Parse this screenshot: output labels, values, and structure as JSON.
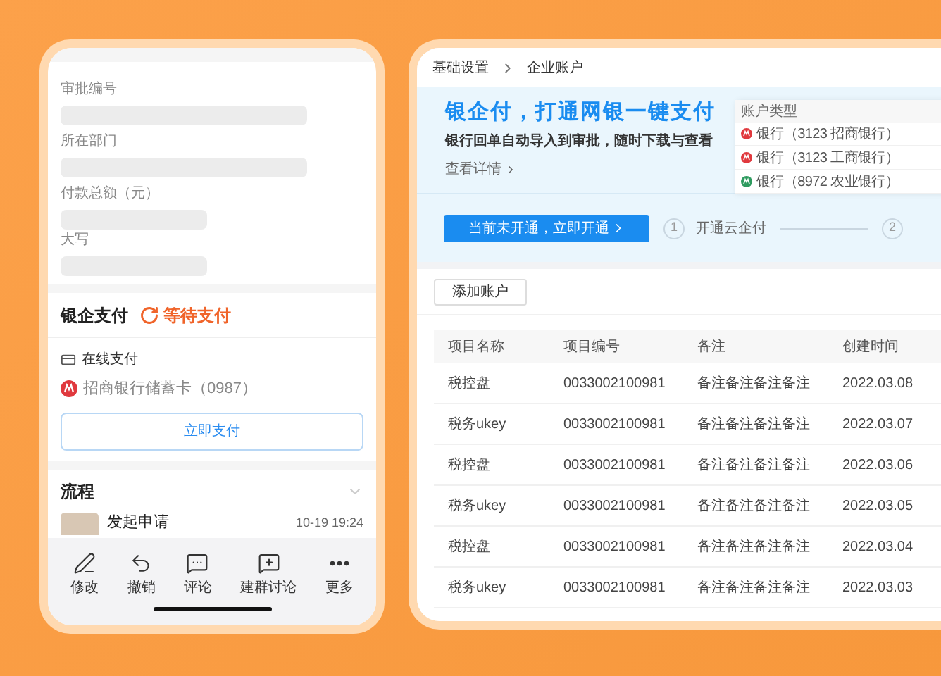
{
  "phone": {
    "fields": [
      {
        "label": "审批编号",
        "kind": "long"
      },
      {
        "label": "所在部门",
        "kind": "long"
      },
      {
        "label": "付款总额（元）",
        "kind": "short"
      },
      {
        "label": "大写",
        "kind": "short"
      }
    ],
    "payment": {
      "title": "银企支付",
      "status": "等待支付",
      "method": "在线支付",
      "card": "招商银行储蓄卡（0987）",
      "button": "立即支付"
    },
    "process": {
      "title": "流程",
      "entries": [
        {
          "action": "发起申请",
          "time": "10-19 19:24"
        }
      ]
    },
    "toolbar": [
      {
        "label": "修改",
        "kind": "edit"
      },
      {
        "label": "撤销",
        "kind": "undo"
      },
      {
        "label": "评论",
        "kind": "comment"
      },
      {
        "label": "建群讨论",
        "kind": "group"
      },
      {
        "label": "更多",
        "kind": "more"
      }
    ]
  },
  "console": {
    "breadcrumb": [
      "基础设置",
      "企业账户"
    ],
    "banner": {
      "title": "银企付，打通网银一键支付",
      "subtitle": "银行回单自动导入到审批，随时下载与查看",
      "link": "查看详情",
      "account_card": {
        "header": "账户类型",
        "accounts": [
          {
            "name": "银行（3123 招商银行）",
            "color": "#e0393e"
          },
          {
            "name": "银行（3123 工商银行）",
            "color": "#e0393e"
          },
          {
            "name": "银行（8972 农业银行）",
            "color": "#2e9b5f"
          }
        ]
      }
    },
    "activate_button": "当前未开通，立即开通",
    "steps": [
      {
        "number": "1",
        "label": "开通云企付"
      },
      {
        "number": "2"
      }
    ],
    "add_button": "添加账户",
    "table": {
      "columns": [
        "项目名称",
        "项目编号",
        "备注",
        "创建时间"
      ],
      "rows": [
        [
          "税控盘",
          "0033002100981",
          "备注备注备注备注",
          "2022.03.08"
        ],
        [
          "税务ukey",
          "0033002100981",
          "备注备注备注备注",
          "2022.03.07"
        ],
        [
          "税控盘",
          "0033002100981",
          "备注备注备注备注",
          "2022.03.06"
        ],
        [
          "税务ukey",
          "0033002100981",
          "备注备注备注备注",
          "2022.03.05"
        ],
        [
          "税控盘",
          "0033002100981",
          "备注备注备注备注",
          "2022.03.04"
        ],
        [
          "税务ukey",
          "0033002100981",
          "备注备注备注备注",
          "2022.03.03"
        ]
      ]
    }
  }
}
